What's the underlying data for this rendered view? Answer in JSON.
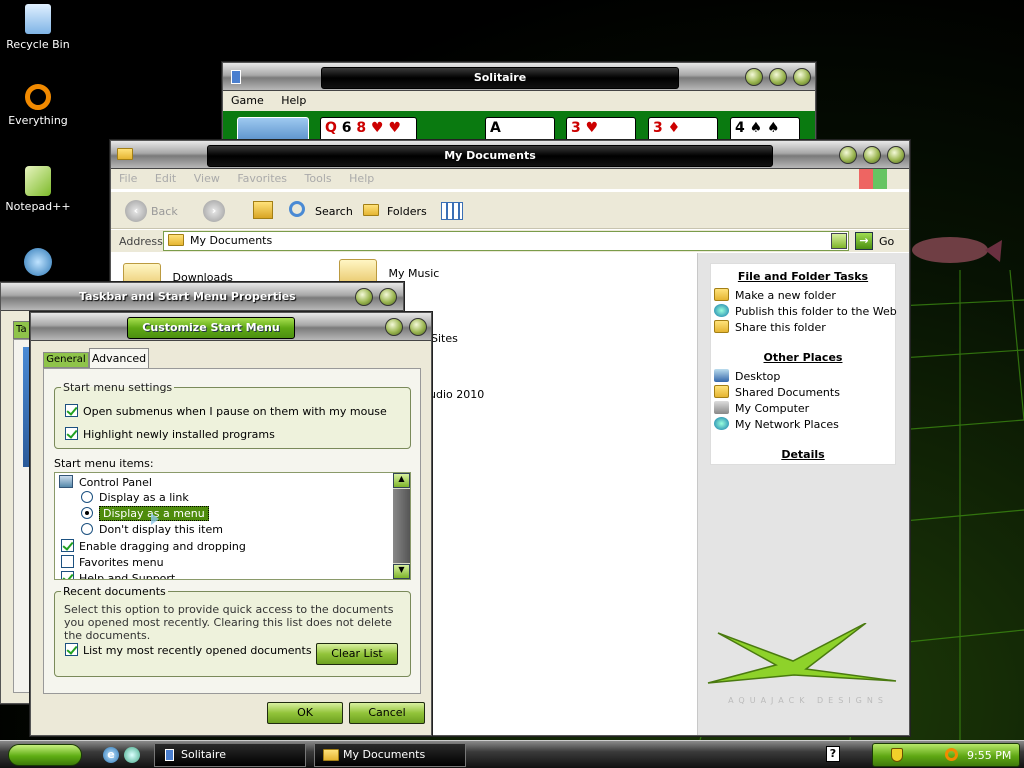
{
  "desktop_icons": [
    {
      "label": "Recycle Bin",
      "icon": "recycle-bin-icon"
    },
    {
      "label": "Everything",
      "icon": "everything-icon"
    },
    {
      "label": "Notepad++",
      "icon": "notepad-icon"
    },
    {
      "label": "",
      "icon": "app-icon"
    }
  ],
  "solitaire": {
    "title": "Solitaire",
    "menu": [
      "Game",
      "Help"
    ],
    "cards": [
      "Q",
      "6",
      "8",
      "A",
      "3",
      "3",
      "4"
    ]
  },
  "mydocs": {
    "title": "My Documents",
    "menu": [
      "File",
      "Edit",
      "View",
      "Favorites",
      "Tools",
      "Help"
    ],
    "toolbar": {
      "back": "Back",
      "search": "Search",
      "folders": "Folders"
    },
    "address_label": "Address",
    "address_value": "My Documents",
    "go": "Go",
    "files": [
      "Downloads",
      "My Music",
      "Sites",
      "udio 2010"
    ],
    "tasks_header": "File and Folder Tasks",
    "tasks": [
      "Make a new folder",
      "Publish this folder to the Web",
      "Share this folder"
    ],
    "places_header": "Other Places",
    "places": [
      "Desktop",
      "Shared Documents",
      "My Computer",
      "My Network Places"
    ],
    "details_header": "Details",
    "watermark": "AQUAJACK DESIGNS"
  },
  "taskbar_props": {
    "title": "Taskbar and Start Menu Properties",
    "tab_stub": "Ta"
  },
  "customize": {
    "title": "Customize Start Menu",
    "tabs": [
      "General",
      "Advanced"
    ],
    "settings_legend": "Start menu settings",
    "settings": [
      {
        "label": "Open submenus when I pause on them with my mouse",
        "checked": true
      },
      {
        "label": "Highlight newly installed programs",
        "checked": true
      }
    ],
    "items_label": "Start menu items:",
    "items": [
      {
        "label": "Control Panel",
        "type": "header"
      },
      {
        "label": "Display as a link",
        "type": "radio",
        "checked": false
      },
      {
        "label": "Display as a menu",
        "type": "radio",
        "checked": true,
        "selected": true
      },
      {
        "label": "Don't display this item",
        "type": "radio",
        "checked": false
      },
      {
        "label": "Enable dragging and dropping",
        "type": "check",
        "checked": true
      },
      {
        "label": "Favorites menu",
        "type": "check",
        "checked": false
      },
      {
        "label": "Help and Support",
        "type": "check",
        "checked": true
      }
    ],
    "recent_legend": "Recent documents",
    "recent_desc": "Select this option to provide quick access to the documents you opened most recently.  Clearing this list does not delete the documents.",
    "recent_check": "List my most recently opened documents",
    "clear_list": "Clear List",
    "ok": "OK",
    "cancel": "Cancel"
  },
  "taskbar": {
    "tasks": [
      "Solitaire",
      "My Documents"
    ],
    "clock": "9:55 PM"
  },
  "colors": {
    "accent": "#6fb51e",
    "title_dark": "#000000",
    "selection": "#4e8c0c"
  }
}
